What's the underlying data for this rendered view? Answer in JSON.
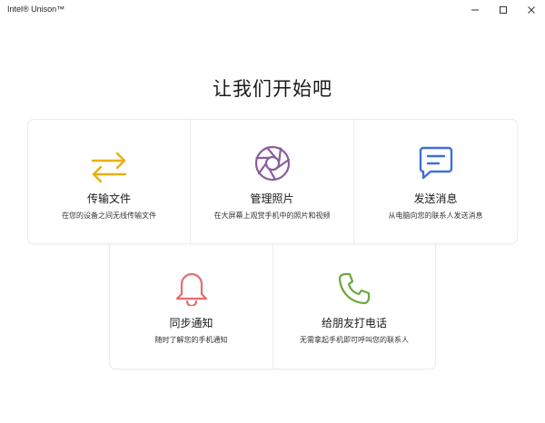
{
  "window": {
    "title": "Intel® Unison™",
    "controls": [
      "minimize-icon",
      "maximize-icon",
      "close-icon"
    ]
  },
  "heading": "让我们开始吧",
  "features": [
    {
      "id": "transfer",
      "icon": "transfer-arrows-icon",
      "color": "#E8B00C",
      "title": "传输文件",
      "description": "在您的设备之间无线传输文件"
    },
    {
      "id": "photos",
      "icon": "aperture-icon",
      "color": "#8A5C9E",
      "title": "管理照片",
      "description": "在大屏幕上观赏手机中的照片和视频"
    },
    {
      "id": "messages",
      "icon": "chat-bubble-icon",
      "color": "#3E6FD9",
      "title": "发送消息",
      "description": "从电脑向您的联系人发送消息"
    },
    {
      "id": "notifications",
      "icon": "bell-icon",
      "color": "#E86C6C",
      "title": "同步通知",
      "description": "随时了解您的手机通知"
    },
    {
      "id": "calls",
      "icon": "phone-icon",
      "color": "#6AA83C",
      "title": "给朋友打电话",
      "description": "无需拿起手机即可呼叫您的联系人"
    }
  ]
}
